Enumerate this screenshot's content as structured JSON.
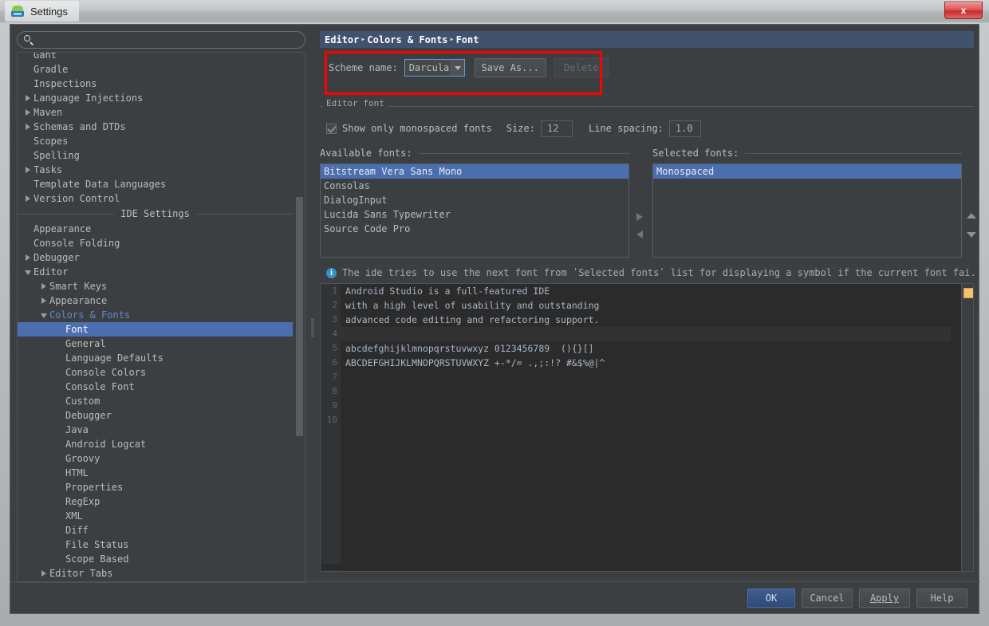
{
  "window": {
    "title": "Settings",
    "app_icon": "android-studio-icon",
    "close_label": "x"
  },
  "search": {
    "placeholder": "",
    "value": "",
    "icon": "search-icon"
  },
  "tree": [
    {
      "label": "Gant",
      "indent": 1,
      "expander": "none",
      "clipped": true
    },
    {
      "label": "Gradle",
      "indent": 1,
      "expander": "none"
    },
    {
      "label": "Inspections",
      "indent": 1,
      "expander": "none"
    },
    {
      "label": "Language Injections",
      "indent": 1,
      "expander": "right"
    },
    {
      "label": "Maven",
      "indent": 1,
      "expander": "right"
    },
    {
      "label": "Schemas and DTDs",
      "indent": 1,
      "expander": "right"
    },
    {
      "label": "Scopes",
      "indent": 1,
      "expander": "none"
    },
    {
      "label": "Spelling",
      "indent": 1,
      "expander": "none"
    },
    {
      "label": "Tasks",
      "indent": 1,
      "expander": "right"
    },
    {
      "label": "Template Data Languages",
      "indent": 1,
      "expander": "none"
    },
    {
      "label": "Version Control",
      "indent": 1,
      "expander": "right"
    }
  ],
  "section_divider": "IDE Settings",
  "tree2": [
    {
      "label": "Appearance",
      "indent": 1,
      "expander": "none"
    },
    {
      "label": "Console Folding",
      "indent": 1,
      "expander": "none"
    },
    {
      "label": "Debugger",
      "indent": 1,
      "expander": "right"
    },
    {
      "label": "Editor",
      "indent": 1,
      "expander": "down"
    },
    {
      "label": "Smart Keys",
      "indent": 2,
      "expander": "right"
    },
    {
      "label": "Appearance",
      "indent": 2,
      "expander": "right"
    },
    {
      "label": "Colors & Fonts",
      "indent": 2,
      "expander": "down",
      "accent": true
    },
    {
      "label": "Font",
      "indent": 3,
      "expander": "none",
      "selected": true
    },
    {
      "label": "General",
      "indent": 3,
      "expander": "none"
    },
    {
      "label": "Language Defaults",
      "indent": 3,
      "expander": "none"
    },
    {
      "label": "Console Colors",
      "indent": 3,
      "expander": "none"
    },
    {
      "label": "Console Font",
      "indent": 3,
      "expander": "none"
    },
    {
      "label": "Custom",
      "indent": 3,
      "expander": "none"
    },
    {
      "label": "Debugger",
      "indent": 3,
      "expander": "none"
    },
    {
      "label": "Java",
      "indent": 3,
      "expander": "none"
    },
    {
      "label": "Android Logcat",
      "indent": 3,
      "expander": "none"
    },
    {
      "label": "Groovy",
      "indent": 3,
      "expander": "none"
    },
    {
      "label": "HTML",
      "indent": 3,
      "expander": "none"
    },
    {
      "label": "Properties",
      "indent": 3,
      "expander": "none"
    },
    {
      "label": "RegExp",
      "indent": 3,
      "expander": "none"
    },
    {
      "label": "XML",
      "indent": 3,
      "expander": "none"
    },
    {
      "label": "Diff",
      "indent": 3,
      "expander": "none"
    },
    {
      "label": "File Status",
      "indent": 3,
      "expander": "none"
    },
    {
      "label": "Scope Based",
      "indent": 3,
      "expander": "none"
    },
    {
      "label": "Editor Tabs",
      "indent": 2,
      "expander": "right"
    }
  ],
  "breadcrumb": {
    "parts": [
      "Editor",
      "Colors & Fonts",
      "Font"
    ],
    "separator": "▸"
  },
  "scheme": {
    "label": "Scheme name:",
    "value": "Darcula",
    "caret_icon": "chevron-down-icon",
    "save_as_label": "Save As...",
    "delete_label": "Delete",
    "delete_disabled": true
  },
  "group": {
    "editor_font_label": "Editor font"
  },
  "font_options": {
    "mono_checkbox_label": "Show only monospaced fonts",
    "mono_checked": true,
    "size_label": "Size:",
    "size_value": "12",
    "line_spacing_label": "Line spacing:",
    "line_spacing_value": "1.0"
  },
  "available_fonts": {
    "header": "Available fonts:",
    "items": [
      "Bitstream Vera Sans Mono",
      "Consolas",
      "DialogInput",
      "Lucida Sans Typewriter",
      "Source Code Pro"
    ],
    "selected_index": 0
  },
  "selected_fonts": {
    "header": "Selected fonts:",
    "items": [
      "Monospaced"
    ],
    "selected_index": 0
  },
  "transfer_icons": {
    "add": "triangle-right-icon",
    "remove": "triangle-left-icon",
    "move_up": "triangle-up-icon",
    "move_down": "triangle-down-icon"
  },
  "info": {
    "icon": "info-icon",
    "glyph": "i",
    "text": "The ide tries to use the next font from ʹSelected fontsʹ list for displaying a symbol if the current font fai..."
  },
  "preview": {
    "line_numbers": [
      "1",
      "2",
      "3",
      "4",
      "5",
      "6",
      "7",
      "8",
      "9",
      "10"
    ],
    "lines": [
      "Android Studio is a full-featured IDE",
      "with a high level of usability and outstanding",
      "advanced code editing and refactoring support.",
      "",
      "abcdefghijklmnopqrstuvwxyz 0123456789  (){}[]",
      "ABCDEFGHIJKLMNOPQRSTUVWXYZ +-*/= .,;:!? #&$%@|^",
      "",
      "",
      "",
      ""
    ],
    "caret_line_index": 3,
    "marker_color": "#f7c16b"
  },
  "buttons": {
    "ok": "OK",
    "cancel": "Cancel",
    "apply": "Apply",
    "help": "Help"
  },
  "colors": {
    "dialog_bg": "#3c3f41",
    "selection_blue": "#4b6eaf",
    "breadcrumb_bg": "#41526e",
    "accent_text": "#5f8bd0",
    "highlight_rect": "#ff0000",
    "editor_bg": "#2b2b2b",
    "code_text": "#a9b7c6",
    "info_icon": "#3592c4"
  }
}
